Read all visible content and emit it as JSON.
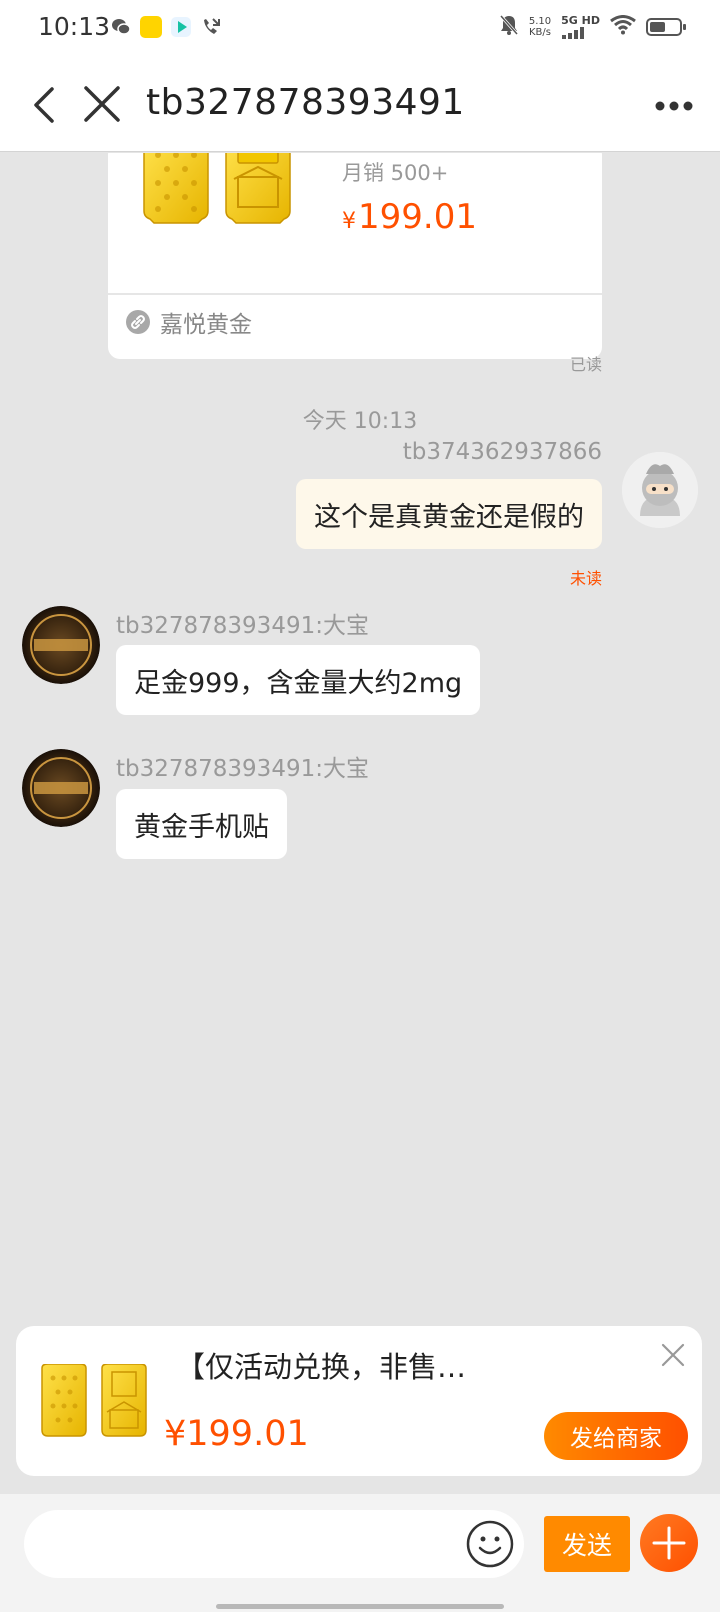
{
  "status_bar": {
    "time": "10:13",
    "net_speed_value": "5.10",
    "net_speed_unit": "KB/s",
    "network": "5G HD",
    "battery_level": 0.55
  },
  "header": {
    "title": "tb327878393491",
    "icons": {
      "back": "chevron-left-icon",
      "close": "close-icon",
      "more": "more-horizontal-icon"
    }
  },
  "chat": {
    "product_card": {
      "sales": "月销 500+",
      "price_symbol": "¥",
      "price_value": "199.01",
      "shop_name": "嘉悦黄金",
      "read_status": "已读"
    },
    "time_divider": "今天 10:13",
    "messages": [
      {
        "from": "me",
        "sender": "tb374362937866",
        "text": "这个是真黄金还是假的",
        "status": "未读"
      },
      {
        "from": "merchant",
        "sender": "tb327878393491:大宝",
        "text": "足金999，含金量大约2mg"
      },
      {
        "from": "merchant",
        "sender": "tb327878393491:大宝",
        "text": "黄金手机贴"
      }
    ]
  },
  "recommend_card": {
    "title": "【仅活动兑换，非售…",
    "price": "¥199.01",
    "action": "发给商家"
  },
  "input_bar": {
    "placeholder": "",
    "send_label": "发送"
  },
  "colors": {
    "accent": "#ff5000",
    "accent_light": "#ff8a00",
    "my_bubble": "#fef8ea",
    "background": "#e5e5e5"
  }
}
